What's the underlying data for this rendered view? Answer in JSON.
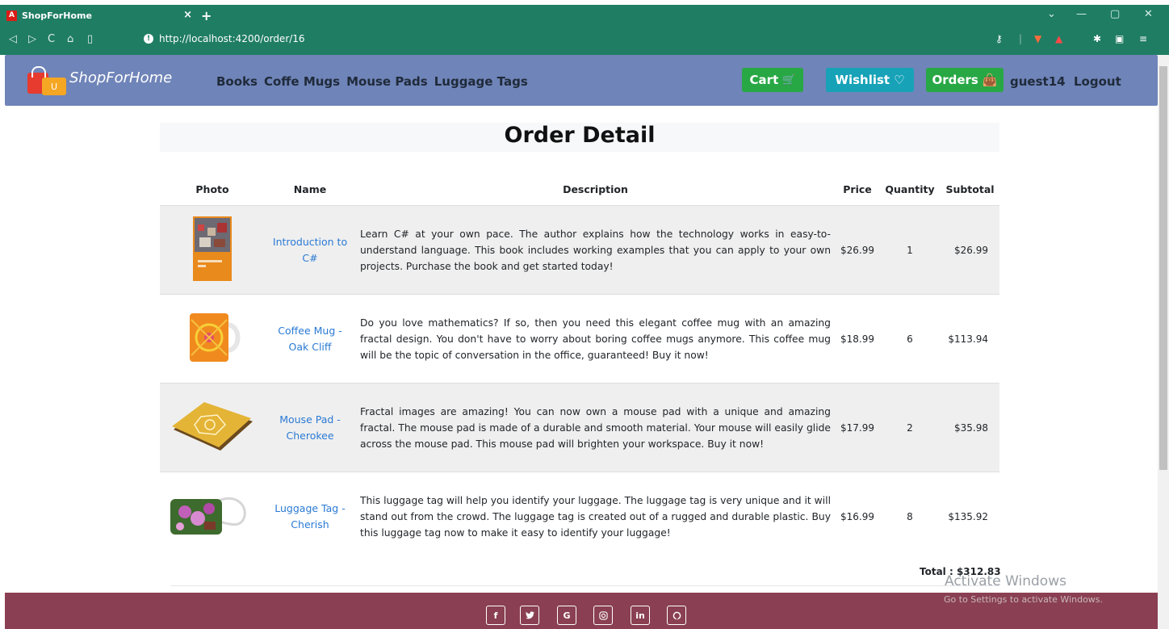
{
  "browser": {
    "tab_title": "ShopForHome",
    "tab_icon": "A",
    "tab_close": "×",
    "new_tab": "+",
    "url": "http://localhost:4200/order/16"
  },
  "navbar": {
    "brand": "ShopForHome",
    "logo_letter": "U",
    "links": [
      "Books",
      "Coffe Mugs",
      "Mouse Pads",
      "Luggage Tags"
    ],
    "cart": "Cart",
    "wishlist": "Wishlist",
    "orders": "Orders",
    "user": "guest14",
    "logout": "Logout",
    "colors": {
      "bar": "#6f84b8",
      "cart": "#28a745",
      "wishlist": "#17a2b8",
      "orders": "#28a745"
    }
  },
  "page": {
    "title": "Order Detail",
    "headers": [
      "Photo",
      "Name",
      "Description",
      "Price",
      "Quantity",
      "Subtotal"
    ],
    "rows": [
      {
        "photo": "book-cover",
        "name": "Introduction to C#",
        "description": "Learn C# at your own pace. The author explains how the technology works in easy-to-understand language. This book includes working examples that you can apply to your own projects. Purchase the book and get started today!",
        "price": "$26.99",
        "quantity": "1",
        "subtotal": "$26.99"
      },
      {
        "photo": "coffee-mug",
        "name": "Coffee Mug - Oak Cliff",
        "description": "Do you love mathematics? If so, then you need this elegant coffee mug with an amazing fractal design. You don't have to worry about boring coffee mugs anymore. This coffee mug will be the topic of conversation in the office, guaranteed! Buy it now!",
        "price": "$18.99",
        "quantity": "6",
        "subtotal": "$113.94"
      },
      {
        "photo": "mouse-pad",
        "name": "Mouse Pad - Cherokee",
        "description": "Fractal images are amazing! You can now own a mouse pad with a unique and amazing fractal. The mouse pad is made of a durable and smooth material. Your mouse will easily glide across the mouse pad. This mouse pad will brighten your workspace. Buy it now!",
        "price": "$17.99",
        "quantity": "2",
        "subtotal": "$35.98"
      },
      {
        "photo": "luggage-tag",
        "name": "Luggage Tag - Cherish",
        "description": "This luggage tag will help you identify your luggage. The luggage tag is very unique and it will stand out from the crowd. The luggage tag is created out of a rugged and durable plastic. Buy this luggage tag now to make it easy to identify your luggage!",
        "price": "$16.99",
        "quantity": "8",
        "subtotal": "$135.92"
      }
    ],
    "total": "Total : $312.83"
  },
  "watermark": {
    "line1": "Activate Windows",
    "line2": "Go to Settings to activate Windows."
  },
  "footer": {
    "social": [
      "f",
      "t",
      "G",
      "ig",
      "in",
      "gh"
    ],
    "color": "#8a4052"
  }
}
